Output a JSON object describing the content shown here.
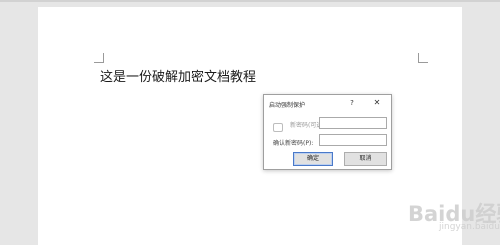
{
  "document": {
    "body_text": "这是一份破解加密文档教程"
  },
  "dialog": {
    "title": "启动强制保护",
    "help_glyph": "?",
    "close_glyph": "✕",
    "password_label": "新密码(可选)(E):",
    "password_value": "",
    "confirm_label": "确认新密码(P):",
    "confirm_value": "",
    "ok_label": "确定",
    "cancel_label": "取消"
  },
  "watermark": {
    "text": "Baidu经验",
    "sub": "jingyan.baidu.com"
  }
}
